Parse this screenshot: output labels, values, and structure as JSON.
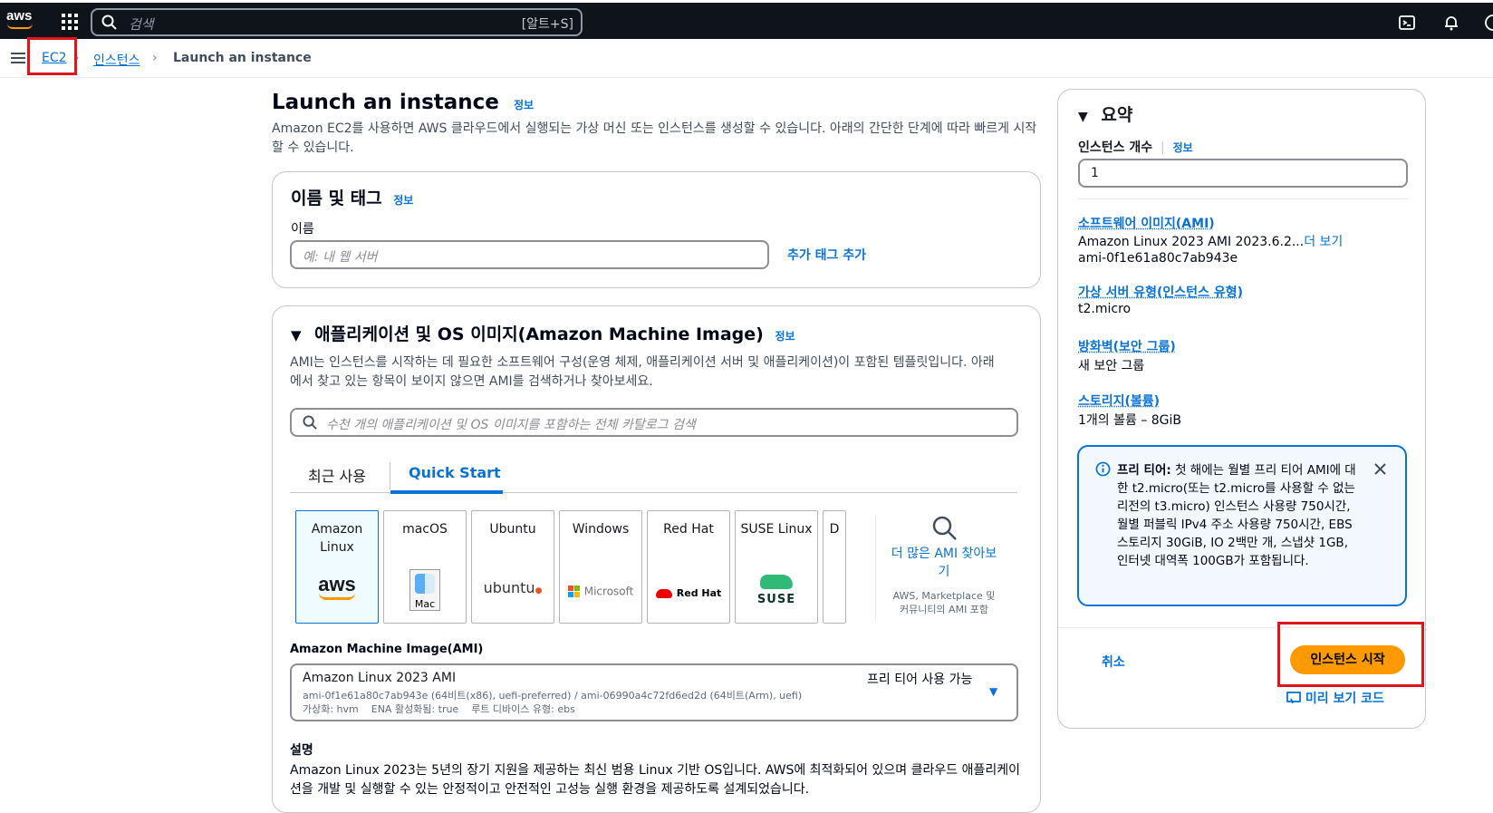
{
  "topnav": {
    "logo_text": "aws",
    "search_placeholder": "검색",
    "search_shortcut": "[알트+S]"
  },
  "breadcrumb": {
    "items": [
      "EC2",
      "인스턴스",
      "Launch an instance"
    ]
  },
  "page": {
    "title": "Launch an instance",
    "info": "정보",
    "description": "Amazon EC2를 사용하면 AWS 클라우드에서 실행되는 가상 머신 또는 인스턴스를 생성할 수 있습니다. 아래의 간단한 단계에 따라 빠르게 시작할 수 있습니다."
  },
  "name_tags": {
    "title": "이름 및 태그",
    "info": "정보",
    "name_label": "이름",
    "name_placeholder": "예: 내 웹 서버",
    "add_tags": "추가 태그 추가"
  },
  "ami_section": {
    "title": "애플리케이션 및 OS 이미지(Amazon Machine Image)",
    "info": "정보",
    "description": "AMI는 인스턴스를 시작하는 데 필요한 소프트웨어 구성(운영 체제, 애플리케이션 서버 및 애플리케이션)이 포함된 템플릿입니다. 아래에서 찾고 있는 항목이 보이지 않으면 AMI를 검색하거나 찾아보세요.",
    "search_placeholder": "수천 개의 애플리케이션 및 OS 이미지를 포함하는 전체 카탈로그 검색",
    "tabs": [
      "최근 사용",
      "Quick Start"
    ],
    "active_tab": "Quick Start",
    "os_tiles": [
      {
        "name": "Amazon Linux",
        "logo": "aws"
      },
      {
        "name": "macOS",
        "logo": "Mac"
      },
      {
        "name": "Ubuntu",
        "logo": "ubuntu"
      },
      {
        "name": "Windows",
        "logo": "Microsoft"
      },
      {
        "name": "Red Hat",
        "logo": "Red Hat"
      },
      {
        "name": "SUSE Linux",
        "logo": "SUSE"
      },
      {
        "name": "D",
        "logo": ""
      }
    ],
    "browse_more": "더 많은 AMI 찾아보기",
    "browse_more_sub": "AWS, Marketplace 및 커뮤니티의 AMI 포함",
    "ami_label": "Amazon Machine Image(AMI)",
    "ami_name": "Amazon Linux 2023 AMI",
    "ami_free": "프리 티어 사용 가능",
    "ami_ids": "ami-0f1e61a80c7ab943e (64비트(x86), uefi-preferred) / ami-06990a4c72fd6ed2d (64비트(Arm), uefi)",
    "ami_meta": "가상화: hvm    ENA 활성화됨: true    루트 디바이스 유형: ebs",
    "desc_label": "설명",
    "desc_text": "Amazon Linux 2023는 5년의 장기 지원을 제공하는 최신 범용 Linux 기반 OS입니다. AWS에 최적화되어 있으며 클라우드 애플리케이션을 개발 및 실행할 수 있는 안정적이고 안전적인 고성능 실행 환경을 제공하도록 설계되었습니다."
  },
  "summary": {
    "title": "요약",
    "count_label": "인스턴스 개수",
    "info": "정보",
    "count_value": "1",
    "ami_link": "소프트웨어 이미지(AMI)",
    "ami_value": "Amazon Linux 2023 AMI 2023.6.2...",
    "ami_more": "더 보기",
    "ami_id": "ami-0f1e61a80c7ab943e",
    "type_link": "가상 서버 유형(인스턴스 유형)",
    "type_value": "t2.micro",
    "fw_link": "방화벽(보안 그룹)",
    "fw_value": "새 보안 그룹",
    "storage_link": "스토리지(볼륨)",
    "storage_value": "1개의 볼륨 – 8GiB",
    "free_tier_bold": "프리 티어:",
    "free_tier_text": "첫 해에는 월별 프리 티어 AMI에 대한 t2.micro(또는 t2.micro를 사용할 수 없는 리전의 t3.micro) 인스턴스 사용량 750시간, 월별 퍼블릭 IPv4 주소 사용량 750시간, EBS 스토리지 30GiB, IO 2백만 개, 스냅샷 1GB, 인터넷 대역폭 100GB가 포함됩니다.",
    "cancel": "취소",
    "launch": "인스턴스 시작",
    "preview_code": "미리 보기 코드"
  }
}
